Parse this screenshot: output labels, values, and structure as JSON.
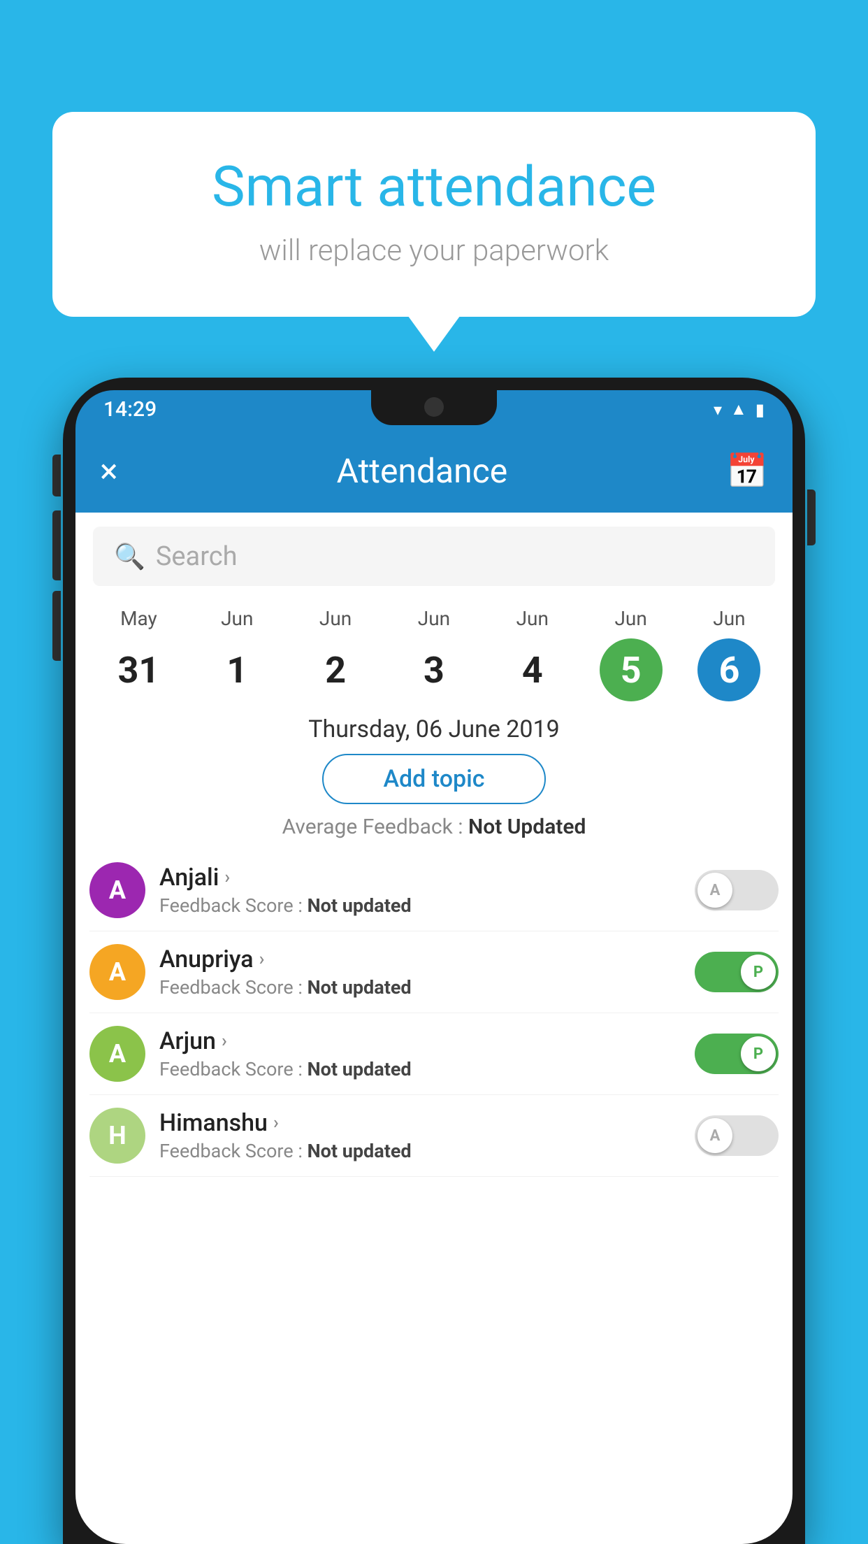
{
  "background_color": "#29b6e8",
  "speech_bubble": {
    "title": "Smart attendance",
    "subtitle": "will replace your paperwork"
  },
  "status_bar": {
    "time": "14:29",
    "icons": [
      "wifi",
      "signal",
      "battery"
    ]
  },
  "app_bar": {
    "title": "Attendance",
    "close_label": "×",
    "calendar_label": "📅"
  },
  "search": {
    "placeholder": "Search"
  },
  "calendar": {
    "days": [
      {
        "month": "May",
        "number": "31",
        "state": "normal"
      },
      {
        "month": "Jun",
        "number": "1",
        "state": "normal"
      },
      {
        "month": "Jun",
        "number": "2",
        "state": "normal"
      },
      {
        "month": "Jun",
        "number": "3",
        "state": "normal"
      },
      {
        "month": "Jun",
        "number": "4",
        "state": "normal"
      },
      {
        "month": "Jun",
        "number": "5",
        "state": "today"
      },
      {
        "month": "Jun",
        "number": "6",
        "state": "selected"
      }
    ]
  },
  "selected_date": "Thursday, 06 June 2019",
  "add_topic_label": "Add topic",
  "average_feedback": {
    "label": "Average Feedback : ",
    "value": "Not Updated"
  },
  "students": [
    {
      "name": "Anjali",
      "avatar_letter": "A",
      "avatar_color": "#9c27b0",
      "feedback_label": "Feedback Score : ",
      "feedback_value": "Not updated",
      "attendance": "absent",
      "toggle_letter": "A"
    },
    {
      "name": "Anupriya",
      "avatar_letter": "A",
      "avatar_color": "#f5a623",
      "feedback_label": "Feedback Score : ",
      "feedback_value": "Not updated",
      "attendance": "present",
      "toggle_letter": "P"
    },
    {
      "name": "Arjun",
      "avatar_letter": "A",
      "avatar_color": "#8bc34a",
      "feedback_label": "Feedback Score : ",
      "feedback_value": "Not updated",
      "attendance": "present",
      "toggle_letter": "P"
    },
    {
      "name": "Himanshu",
      "avatar_letter": "H",
      "avatar_color": "#aed581",
      "feedback_label": "Feedback Score : ",
      "feedback_value": "Not updated",
      "attendance": "absent",
      "toggle_letter": "A"
    }
  ]
}
